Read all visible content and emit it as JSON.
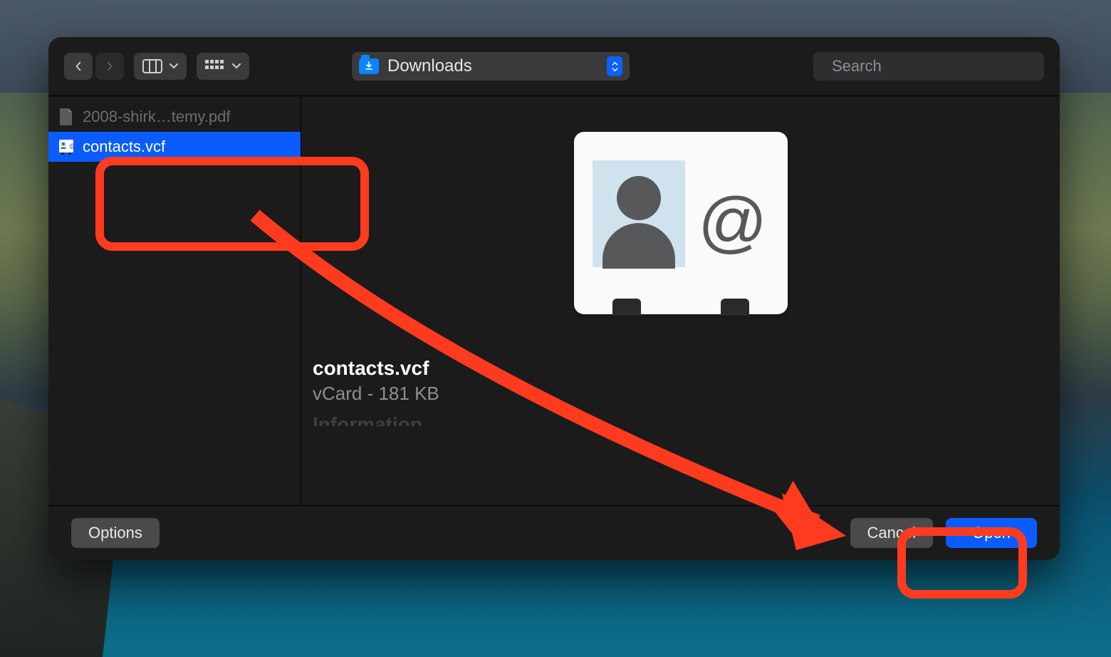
{
  "toolbar": {
    "location_label": "Downloads",
    "search_placeholder": "Search"
  },
  "files": [
    {
      "name": "2008-shirk…temy.pdf",
      "selected": false,
      "dimmed": true
    },
    {
      "name": "contacts.vcf",
      "selected": true,
      "dimmed": false
    }
  ],
  "preview": {
    "filename": "contacts.vcf",
    "kind_size": "vCard - 181 KB",
    "info_heading": "Information"
  },
  "footer": {
    "options_label": "Options",
    "cancel_label": "Cancel",
    "open_label": "Open"
  }
}
